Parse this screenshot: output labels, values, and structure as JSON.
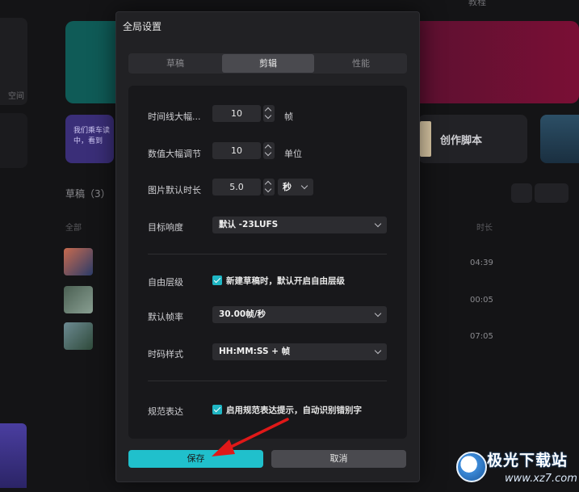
{
  "background": {
    "left_label": "空间",
    "promo_card": "我们乘车读中，看到",
    "script_card": "创作脚本",
    "drafts_label": "草稿（3）",
    "col_all": "全部",
    "col_duration": "时长",
    "top_label": "教程",
    "durations": [
      "04:39",
      "00:05",
      "07:05"
    ]
  },
  "modal": {
    "title": "全局设置",
    "tabs": [
      {
        "label": "草稿",
        "active": false
      },
      {
        "label": "剪辑",
        "active": true
      },
      {
        "label": "性能",
        "active": false
      }
    ],
    "timeline_step": {
      "label": "时间线大幅...",
      "value": "10",
      "unit": "帧"
    },
    "numeric_step": {
      "label": "数值大幅调节",
      "value": "10",
      "unit": "单位"
    },
    "image_duration": {
      "label": "图片默认时长",
      "value": "5.0",
      "unit": "秒"
    },
    "loudness": {
      "label": "目标响度",
      "value": "默认 -23LUFS"
    },
    "free_layer": {
      "label": "自由层级",
      "checked": true,
      "text": "新建草稿时，默认开启自由层级"
    },
    "frame_rate": {
      "label": "默认帧率",
      "value": "30.00帧/秒"
    },
    "timecode": {
      "label": "时码样式",
      "value": "HH:MM:SS + 帧"
    },
    "standard_expr": {
      "label": "规范表达",
      "checked": true,
      "text": "启用规范表达提示，自动识别错别字"
    },
    "save_label": "保存",
    "cancel_label": "取消"
  },
  "watermark": {
    "name": "极光下载站",
    "url": "www.xz7.com"
  },
  "colors": {
    "accent": "#20c0cc",
    "arrow": "#e01818",
    "modal_bg": "#212124",
    "panel_bg": "#18181b"
  }
}
